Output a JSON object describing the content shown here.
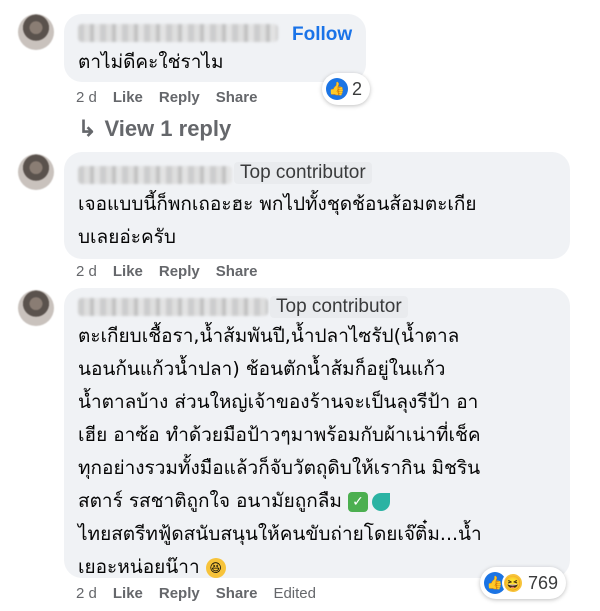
{
  "comments": [
    {
      "follow_label": "Follow",
      "text": "ตาไม่ดีคะใช่ราไม",
      "time": "2 d",
      "like": "Like",
      "reply": "Reply",
      "share": "Share",
      "reaction_count": "2",
      "view_replies": "View 1 reply"
    },
    {
      "badge": "Top contributor",
      "text": "เจอแบบนี้ก็พกเถอะฮะ พกไปทั้งชุดช้อนส้อมตะเกีย\nบเลยอ่ะครับ",
      "time": "2 d",
      "like": "Like",
      "reply": "Reply",
      "share": "Share"
    },
    {
      "badge": "Top contributor",
      "text_lines": [
        "ตะเกียบเชื้อรา,น้ำส้มพันปี,น้ำปลาไซรัป(น้ำตาล",
        "นอนก้นแก้วน้ำปลา) ช้อนตักน้ำส้มก็อยู่ในแก้ว",
        "น้ำตาลบ้าง ส่วนใหญ่เจ้าของร้านจะเป็นลุงรีป้า อา",
        "เฮีย อาซ้อ ทำด้วยมือป้าวๆมาพร้อมกับผ้าเน่าที่เช็ค",
        "ทุกอย่างรวมทั้งมือแล้วก็จับวัตถุดิบให้เรากิน มิชริน",
        "สตาร์ รสชาติถูกใจ อนามัยถูกลืม",
        "ไทยสตรีทฟู้ดสนับสนุนให้คนขับถ่ายโดยเจ๊ติ๋ม...น้ำ",
        "เยอะหน่อยน๊าา"
      ],
      "time": "2 d",
      "like": "Like",
      "reply": "Reply",
      "share": "Share",
      "edited": "Edited",
      "reaction_count": "769"
    }
  ],
  "colors": {
    "bubble": "#f0f2f5",
    "link_blue": "#1a73e8",
    "meta_gray": "#65676b",
    "like_blue": "#1b74e4"
  }
}
